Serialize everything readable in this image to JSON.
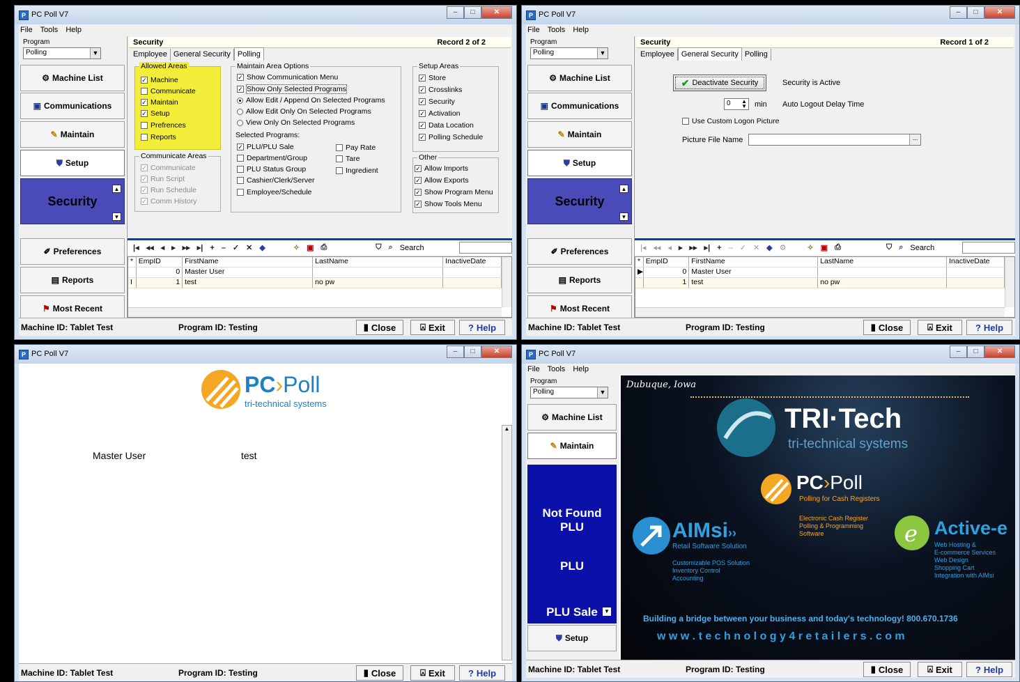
{
  "app": {
    "window_title": "PC Poll V7",
    "menu": [
      "File",
      "Tools",
      "Help"
    ],
    "program_label": "Program",
    "program_value": "Polling"
  },
  "nav": {
    "machine_list": "Machine List",
    "communications": "Communications",
    "maintain": "Maintain",
    "setup": "Setup",
    "security": "Security",
    "preferences": "Preferences",
    "reports": "Reports",
    "most_recent": "Most Recent"
  },
  "status": {
    "machine_id": "Machine ID: Tablet Test",
    "program_id": "Program ID: Testing",
    "close": "Close",
    "exit": "Exit",
    "help": "Help"
  },
  "security": {
    "title": "Security",
    "tabs": [
      "Employee",
      "General Security",
      "Polling"
    ],
    "w1_record": "Record  2  of  2",
    "w2_record": "Record  1  of  2"
  },
  "polling_tab": {
    "allowed_areas_title": "Allowed Areas",
    "allowed_areas": [
      {
        "label": "Machine",
        "checked": true
      },
      {
        "label": "Communicate",
        "checked": false
      },
      {
        "label": "Maintain",
        "checked": true
      },
      {
        "label": "Setup",
        "checked": true
      },
      {
        "label": "Prefrences",
        "checked": false
      },
      {
        "label": "Reports",
        "checked": false
      }
    ],
    "communicate_areas_title": "Communicate Areas",
    "communicate_areas": [
      "Communicate",
      "Run Script",
      "Run Schedule",
      "Comm History"
    ],
    "maintain_options_title": "Maintain Area Options",
    "maintain_checks": [
      {
        "label": "Show Communication Menu",
        "checked": true
      },
      {
        "label": "Show Only Selected Programs",
        "checked": true
      }
    ],
    "maintain_radios": [
      {
        "label": "Allow Edit / Append On Selected Programs",
        "on": true
      },
      {
        "label": "Allow Edit Only On Selected Programs",
        "on": false
      },
      {
        "label": "View Only On Selected Programs",
        "on": false
      }
    ],
    "selected_programs_title": "Selected Programs:",
    "selected_programs_left": [
      {
        "label": "PLU/PLU Sale",
        "checked": true
      },
      {
        "label": "Department/Group",
        "checked": false
      },
      {
        "label": "PLU Status Group",
        "checked": false
      },
      {
        "label": "Cashier/Clerk/Server",
        "checked": false
      },
      {
        "label": "Employee/Schedule",
        "checked": false
      }
    ],
    "selected_programs_right": [
      {
        "label": "Pay Rate",
        "checked": false
      },
      {
        "label": "Tare",
        "checked": false
      },
      {
        "label": "Ingredient",
        "checked": false
      }
    ],
    "setup_areas_title": "Setup Areas",
    "setup_areas": [
      "Store",
      "Crosslinks",
      "Security",
      "Activation",
      "Data Location",
      "Polling Schedule"
    ],
    "other_title": "Other",
    "other": [
      "Allow Imports",
      "Allow Exports",
      "Show Program Menu",
      "Show Tools Menu"
    ]
  },
  "general_tab": {
    "deactivate_button": "Deactivate Security",
    "security_status": "Security is Active",
    "logout_value": "0",
    "logout_unit": "min",
    "logout_label": "Auto Logout Delay Time",
    "custom_logon": "Use Custom Logon Picture",
    "picture_label": "Picture File Name",
    "browse": "..."
  },
  "toolbar": {
    "search_label": "Search"
  },
  "grid": {
    "columns": [
      "EmpID",
      "FirstName",
      "LastName",
      "InactiveDate"
    ],
    "rows": [
      [
        "0",
        "Master User",
        "",
        ""
      ],
      [
        "1",
        "test",
        "no pw",
        ""
      ]
    ]
  },
  "login": {
    "logo_main": "PC",
    "logo_poll": "Poll",
    "logo_sub": "tri-technical systems",
    "user1": "Master User",
    "user2": "test"
  },
  "win4": {
    "nav_machine_list": "Machine List",
    "nav_maintain": "Maintain",
    "not_found": "Not Found PLU",
    "plu": "PLU",
    "plu_sale": "PLU Sale",
    "setup": "Setup"
  },
  "banner": {
    "location": "Dubuque, Iowa",
    "tri_tech": "TRI·Tech",
    "tri_sub": "tri-technical systems",
    "pcpoll_sub": "Polling for Cash Registers",
    "pcpoll_desc": [
      "Electronic Cash Register",
      "Polling & Programming",
      "Software"
    ],
    "aimsi": "AIMsi",
    "aimsi_sub": "Retail Software Solution",
    "aimsi_desc": [
      "Customizable POS Solution",
      "Inventory Control",
      "Accounting"
    ],
    "active_e": "Active-e",
    "active_desc": [
      "Web Hosting &",
      "E-commerce Services",
      "Web Design",
      "Shopping Cart",
      "Integration with AIMsi"
    ],
    "tagline": "Building a bridge between your business and today's technology!  800.670.1736",
    "url": "w w w . t e c h n o l o g y 4 r e t a i l e r s . c o m"
  },
  "colors": {
    "accent": "#1e3a8a",
    "highlight": "#f2ee3a",
    "security_blue": "#4a4ab8",
    "banner_bg": "#05070c"
  }
}
